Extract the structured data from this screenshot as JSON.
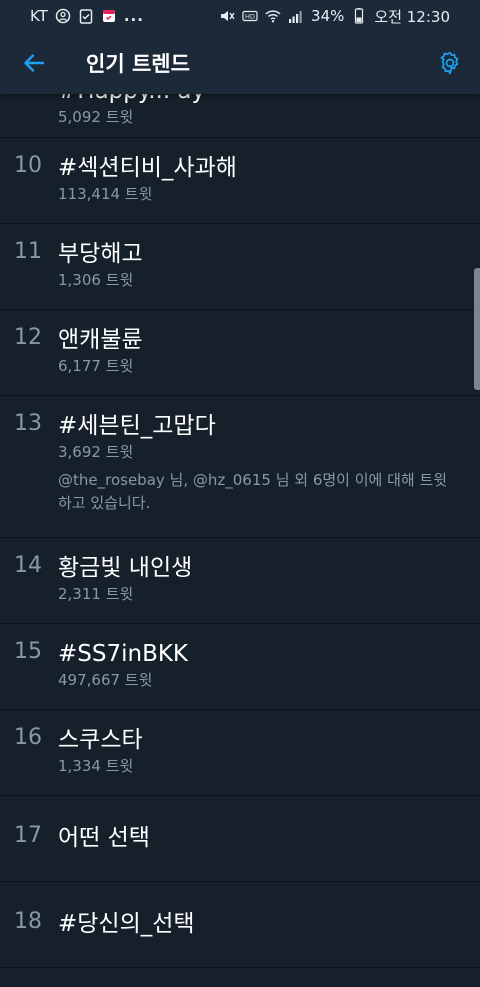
{
  "status_bar": {
    "carrier": "KT",
    "dots": "...",
    "battery": "34%",
    "time": "오전 12:30"
  },
  "header": {
    "title": "인기 트렌드"
  },
  "partial_trend": {
    "name": "#Happy... ay",
    "count": "5,092 트윗"
  },
  "trends": [
    {
      "rank": "10",
      "name": "#섹션티비_사과해",
      "count": "113,414 트윗"
    },
    {
      "rank": "11",
      "name": "부당해고",
      "count": "1,306 트윗"
    },
    {
      "rank": "12",
      "name": "앤캐불륜",
      "count": "6,177 트윗"
    },
    {
      "rank": "13",
      "name": "#세븐틴_고맙다",
      "count": "3,692 트윗",
      "context": "@the_rosebay 님, @hz_0615 님 외 6명이 이에 대해 트윗하고 있습니다."
    },
    {
      "rank": "14",
      "name": "황금빛 내인생",
      "count": "2,311 트윗"
    },
    {
      "rank": "15",
      "name": "#SS7inBKK",
      "count": "497,667 트윗"
    },
    {
      "rank": "16",
      "name": "스쿠스타",
      "count": "1,334 트윗"
    },
    {
      "rank": "17",
      "name": "어떤 선택",
      "count": ""
    },
    {
      "rank": "18",
      "name": "#당신의_선택",
      "count": ""
    }
  ],
  "colors": {
    "background": "#15202b",
    "bar": "#1c2938",
    "accent": "#1da1f2",
    "muted_text": "#8899a6"
  }
}
